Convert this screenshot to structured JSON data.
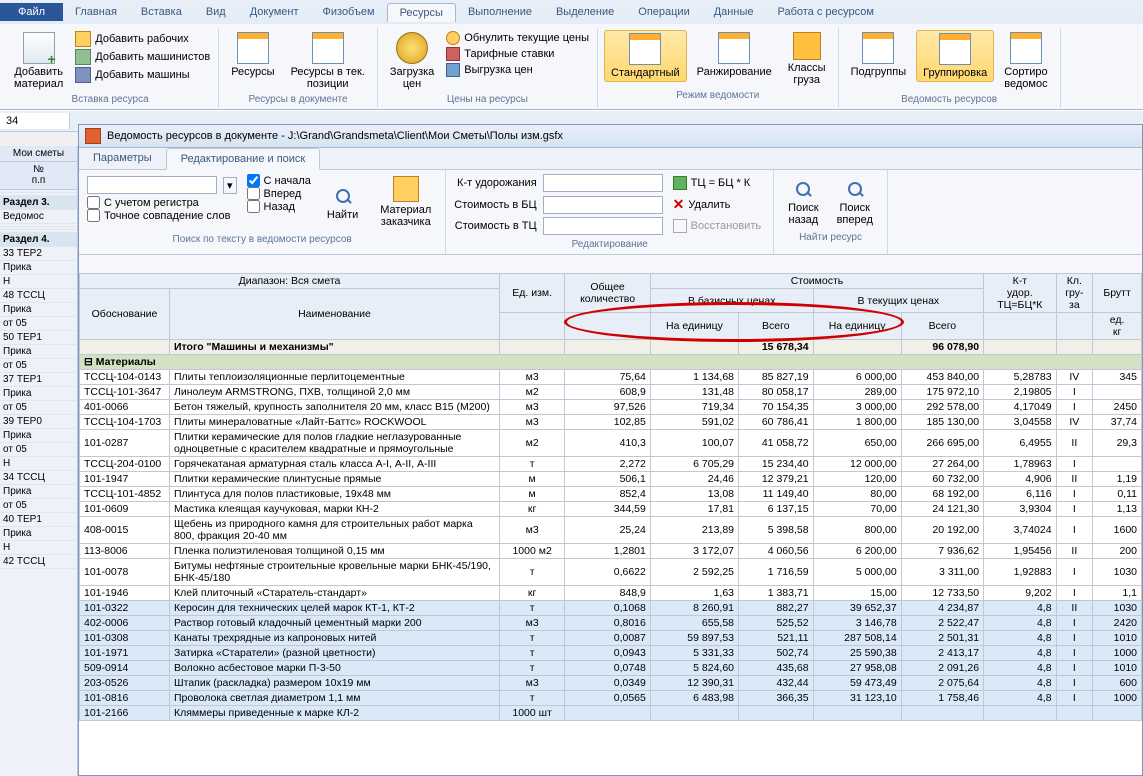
{
  "tabs": {
    "file": "Файл",
    "main": "Главная",
    "insert": "Вставка",
    "view": "Вид",
    "doc": "Документ",
    "phys": "Физобъем",
    "res": "Ресурсы",
    "exec": "Выполнение",
    "sel": "Выделение",
    "ops": "Операции",
    "data": "Данные",
    "work": "Работа с ресурсом"
  },
  "ribbon": {
    "addMaterial": "Добавить\nматериал",
    "addWorkers": "Добавить рабочих",
    "addMachinists": "Добавить машинистов",
    "addMachines": "Добавить машины",
    "resources": "Ресурсы",
    "resInCur": "Ресурсы в тек.\nпозиции",
    "loadPrices": "Загрузка\nцен",
    "zeroCurPrices": "Обнулить текущие цены",
    "tariffRates": "Тарифные ставки",
    "exportPrices": "Выгрузка цен",
    "standard": "Стандартный",
    "ranking": "Ранжирование",
    "cargoClasses": "Классы\nгруза",
    "subgroups": "Подгруппы",
    "grouping": "Группировка",
    "sorting": "Сортиро\nведомос",
    "g1": "Вставка ресурса",
    "g2": "Ресурсы в документе",
    "g3": "Цены на ресурсы",
    "g4": "Режим ведомости",
    "g5": "Ведомость ресурсов"
  },
  "cell": "34",
  "leftTab": "Мои сметы",
  "leftHeader": {
    "c1": "№\nп.п"
  },
  "leftRows": [
    "",
    "",
    "Раздел 3.",
    "Ведомос",
    "",
    "",
    "",
    "Раздел 4.",
    "33 ТЕР2",
    "Прика",
    "Н",
    "48 ТССЦ",
    "Прика",
    "от 05",
    "50 ТЕР1",
    "Прика",
    "от 05",
    "37 ТЕР1",
    "Прика",
    "от 05",
    "39 ТЕР0",
    "Прика",
    "от 05",
    "Н",
    "34 ТССЦ",
    "Прика",
    "от 05",
    "40 ТЕР1",
    "Прика",
    "Н",
    "42 ТССЦ"
  ],
  "docTitle": "Ведомость ресурсов в документе - J:\\Grand\\Grandsmeta\\Client\\Мои Сметы\\Полы изм.gsfx",
  "subTabs": {
    "params": "Параметры",
    "edit": "Редактирование и поиск"
  },
  "search": {
    "fromStart": "С начала",
    "register": "С учетом регистра",
    "exact": "Точное совпадение слов",
    "forward": "Вперед",
    "back": "Назад",
    "find": "Найти",
    "customerMat": "Материал\nзаказчика",
    "groupLabel": "Поиск по тексту в ведомости ресурсов"
  },
  "edit": {
    "coef": "К-т удорожания",
    "costBase": "Стоимость в БЦ",
    "costCur": "Стоимость в ТЦ",
    "formula": "ТЦ = БЦ * К",
    "delete": "Удалить",
    "restore": "Восстановить",
    "groupLabel": "Редактирование"
  },
  "nav": {
    "back": "Поиск\nназад",
    "fwd": "Поиск\nвперед",
    "groupLabel": "Найти ресурс"
  },
  "grid": {
    "diapason": "Диапазон: Вся смета",
    "totalQty": "Общее\nколичество",
    "cost": "Стоимость",
    "coefK": "К-т\nудор.\nТЦ=БЦ*К",
    "cargoCl": "Кл.\nгру-\nза",
    "gross": "Брутт",
    "basePrices": "В базисных ценах",
    "curPrices": "В текущих ценах",
    "basis": "Обоснование",
    "name": "Наименование",
    "unit": "Ед. изм.",
    "perUnit": "На единицу",
    "total": "Всего",
    "unitWeight": "ед.\nкг",
    "totalMachines": "Итого \"Машины и механизмы\"",
    "materials": "Материалы"
  },
  "rows": [
    {
      "b": "ТССЦ-104-0143",
      "n": "Плиты теплоизоляционные перлитоцементные",
      "u": "м3",
      "q": "75,64",
      "bu": "1 134,68",
      "bt": "85 827,19",
      "cu": "6 000,00",
      "ct": "453 840,00",
      "k": "5,28783",
      "cl": "IV",
      "w": "345"
    },
    {
      "b": "ТССЦ-101-3647",
      "n": "Линолеум ARMSTRONG, ПХВ, толщиной 2,0 мм",
      "u": "м2",
      "q": "608,9",
      "bu": "131,48",
      "bt": "80 058,17",
      "cu": "289,00",
      "ct": "175 972,10",
      "k": "2,19805",
      "cl": "I",
      "w": ""
    },
    {
      "b": "401-0066",
      "n": "Бетон тяжелый, крупность заполнителя 20 мм, класс В15 (М200)",
      "u": "м3",
      "q": "97,526",
      "bu": "719,34",
      "bt": "70 154,35",
      "cu": "3 000,00",
      "ct": "292 578,00",
      "k": "4,17049",
      "cl": "I",
      "w": "2450"
    },
    {
      "b": "ТССЦ-104-1703",
      "n": "Плиты минераловатные «Лайт-Баттс» ROCKWOOL",
      "u": "м3",
      "q": "102,85",
      "bu": "591,02",
      "bt": "60 786,41",
      "cu": "1 800,00",
      "ct": "185 130,00",
      "k": "3,04558",
      "cl": "IV",
      "w": "37,74"
    },
    {
      "b": "101-0287",
      "n": "Плитки керамические для полов гладкие неглазурованные одноцветные с красителем квадратные и прямоугольные",
      "u": "м2",
      "q": "410,3",
      "bu": "100,07",
      "bt": "41 058,72",
      "cu": "650,00",
      "ct": "266 695,00",
      "k": "6,4955",
      "cl": "II",
      "w": "29,3"
    },
    {
      "b": "ТССЦ-204-0100",
      "n": "Горячекатаная арматурная сталь класса А-I, А-II, А-III",
      "u": "т",
      "q": "2,272",
      "bu": "6 705,29",
      "bt": "15 234,40",
      "cu": "12 000,00",
      "ct": "27 264,00",
      "k": "1,78963",
      "cl": "I",
      "w": ""
    },
    {
      "b": "101-1947",
      "n": "Плитки керамические плинтусные прямые",
      "u": "м",
      "q": "506,1",
      "bu": "24,46",
      "bt": "12 379,21",
      "cu": "120,00",
      "ct": "60 732,00",
      "k": "4,906",
      "cl": "II",
      "w": "1,19"
    },
    {
      "b": "ТССЦ-101-4852",
      "n": "Плинтуса для полов пластиковые, 19х48 мм",
      "u": "м",
      "q": "852,4",
      "bu": "13,08",
      "bt": "11 149,40",
      "cu": "80,00",
      "ct": "68 192,00",
      "k": "6,116",
      "cl": "I",
      "w": "0,11"
    },
    {
      "b": "101-0609",
      "n": "Мастика клеящая каучуковая, марки КН-2",
      "u": "кг",
      "q": "344,59",
      "bu": "17,81",
      "bt": "6 137,15",
      "cu": "70,00",
      "ct": "24 121,30",
      "k": "3,9304",
      "cl": "I",
      "w": "1,13"
    },
    {
      "b": "408-0015",
      "n": "Щебень из природного камня для строительных работ марка 800, фракция 20-40 мм",
      "u": "м3",
      "q": "25,24",
      "bu": "213,89",
      "bt": "5 398,58",
      "cu": "800,00",
      "ct": "20 192,00",
      "k": "3,74024",
      "cl": "I",
      "w": "1600"
    },
    {
      "b": "113-8006",
      "n": "Пленка полиэтиленовая толщиной 0,15 мм",
      "u": "1000 м2",
      "q": "1,2801",
      "bu": "3 172,07",
      "bt": "4 060,56",
      "cu": "6 200,00",
      "ct": "7 936,62",
      "k": "1,95456",
      "cl": "II",
      "w": "200"
    },
    {
      "b": "101-0078",
      "n": "Битумы нефтяные строительные кровельные марки БНК-45/190, БНК-45/180",
      "u": "т",
      "q": "0,6622",
      "bu": "2 592,25",
      "bt": "1 716,59",
      "cu": "5 000,00",
      "ct": "3 311,00",
      "k": "1,92883",
      "cl": "I",
      "w": "1030"
    },
    {
      "b": "101-1946",
      "n": "Клей плиточный «Старатель-стандарт»",
      "u": "кг",
      "q": "848,9",
      "bu": "1,63",
      "bt": "1 383,71",
      "cu": "15,00",
      "ct": "12 733,50",
      "k": "9,202",
      "cl": "I",
      "w": "1,1"
    },
    {
      "hl": true,
      "b": "101-0322",
      "n": "Керосин для технических целей марок КТ-1, КТ-2",
      "u": "т",
      "q": "0,1068",
      "bu": "8 260,91",
      "bt": "882,27",
      "cu": "39 652,37",
      "ct": "4 234,87",
      "k": "4,8",
      "cl": "II",
      "w": "1030"
    },
    {
      "hl": true,
      "b": "402-0006",
      "n": "Раствор готовый кладочный цементный марки 200",
      "u": "м3",
      "q": "0,8016",
      "bu": "655,58",
      "bt": "525,52",
      "cu": "3 146,78",
      "ct": "2 522,47",
      "k": "4,8",
      "cl": "I",
      "w": "2420"
    },
    {
      "hl": true,
      "b": "101-0308",
      "n": "Канаты трехрядные из капроновых нитей",
      "u": "т",
      "q": "0,0087",
      "bu": "59 897,53",
      "bt": "521,11",
      "cu": "287 508,14",
      "ct": "2 501,31",
      "k": "4,8",
      "cl": "I",
      "w": "1010"
    },
    {
      "hl": true,
      "b": "101-1971",
      "n": "Затирка «Старатели» (разной цветности)",
      "u": "т",
      "q": "0,0943",
      "bu": "5 331,33",
      "bt": "502,74",
      "cu": "25 590,38",
      "ct": "2 413,17",
      "k": "4,8",
      "cl": "I",
      "w": "1000"
    },
    {
      "hl": true,
      "b": "509-0914",
      "n": "Волокно асбестовое марки П-3-50",
      "u": "т",
      "q": "0,0748",
      "bu": "5 824,60",
      "bt": "435,68",
      "cu": "27 958,08",
      "ct": "2 091,26",
      "k": "4,8",
      "cl": "I",
      "w": "1010"
    },
    {
      "hl": true,
      "b": "203-0526",
      "n": "Штапик (раскладка) размером 10х19 мм",
      "u": "м3",
      "q": "0,0349",
      "bu": "12 390,31",
      "bt": "432,44",
      "cu": "59 473,49",
      "ct": "2 075,64",
      "k": "4,8",
      "cl": "I",
      "w": "600"
    },
    {
      "hl": true,
      "b": "101-0816",
      "n": "Проволока светлая диаметром 1,1 мм",
      "u": "т",
      "q": "0,0565",
      "bu": "6 483,98",
      "bt": "366,35",
      "cu": "31 123,10",
      "ct": "1 758,46",
      "k": "4,8",
      "cl": "I",
      "w": "1000"
    },
    {
      "hl": true,
      "b": "101-2166",
      "n": "Кляммеры приведенные к марке КЛ-2",
      "u": "1000 шт",
      "q": "",
      "bu": "",
      "bt": "",
      "cu": "",
      "ct": "",
      "k": "",
      "cl": "",
      "w": ""
    }
  ],
  "totalsRow": {
    "bt": "15 678,34",
    "ct": "96 078,90"
  }
}
